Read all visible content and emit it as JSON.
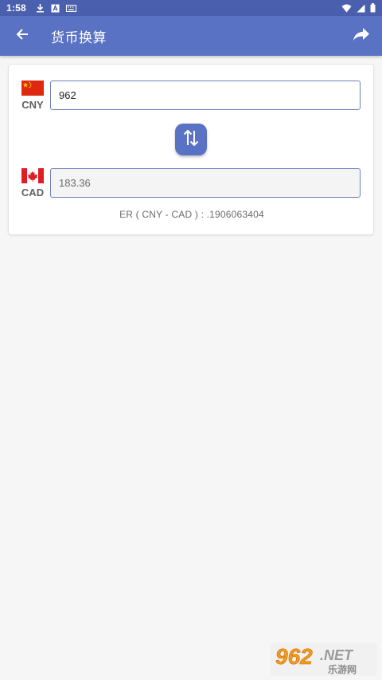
{
  "status_bar": {
    "time": "1:58",
    "left_icons": [
      "download-icon",
      "font-a-icon",
      "keyboard-icon"
    ],
    "right_icons": [
      "wifi-icon",
      "signal-icon",
      "battery-icon"
    ]
  },
  "app_bar": {
    "title": "货币换算",
    "back_icon": "arrow-left-icon",
    "share_icon": "share-icon",
    "color": "#5a72c3"
  },
  "converter": {
    "from": {
      "code": "CNY",
      "amount": "962",
      "flag": "china-flag"
    },
    "to": {
      "code": "CAD",
      "amount": "183.36",
      "flag": "canada-flag"
    },
    "swap_icon": "swap-arrows-icon",
    "rate_text": "ER ( CNY - CAD ) :  .1906063404"
  },
  "watermark": {
    "number": "962",
    "suffix": ".NET",
    "subtitle": "乐游网"
  }
}
